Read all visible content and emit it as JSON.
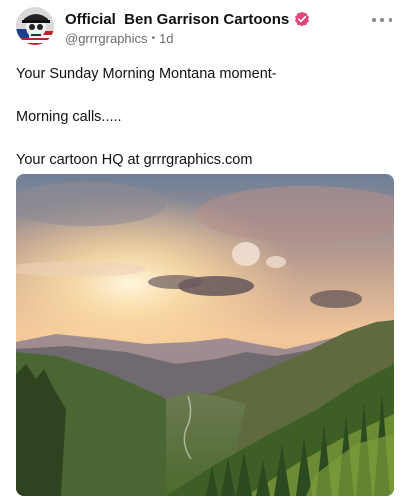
{
  "post": {
    "author_name": "Official  Ben Garrison Cartoons",
    "handle": "@grrrgraphics",
    "separator": "•",
    "time": "1d",
    "body_lines": [
      "Your Sunday Morning Montana moment-",
      "Morning calls.....",
      "Your cartoon HQ at grrrgraphics.com"
    ],
    "verified_color": "#e0457b",
    "icons": {
      "avatar": "cartoon-avatar",
      "verified": "verified-badge-icon",
      "more": "more-options-icon",
      "media": "mountain-sunrise-photo"
    }
  }
}
